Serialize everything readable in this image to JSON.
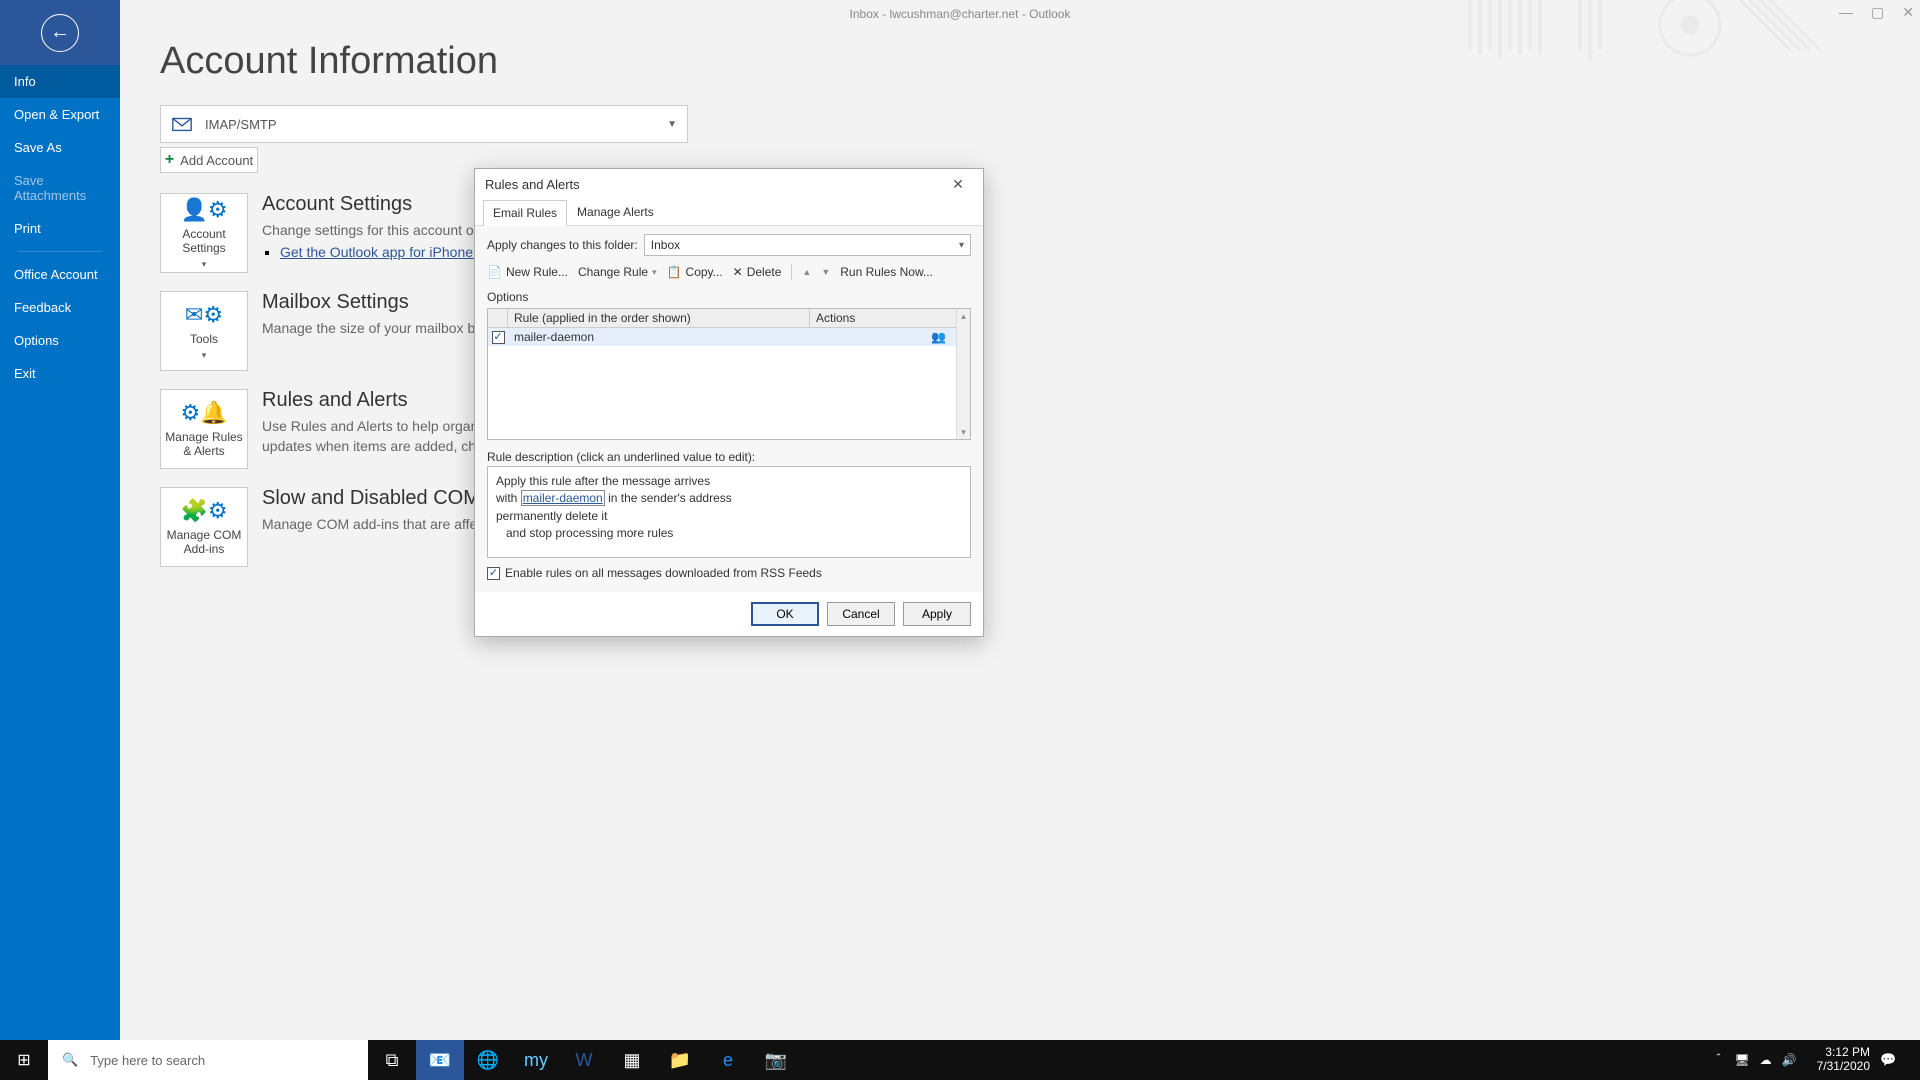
{
  "window_title": "Inbox - lwcushman@charter.net  -  Outlook",
  "back": "←",
  "sidebar": {
    "items": [
      "Info",
      "Open & Export",
      "Save As",
      "Save Attachments",
      "Print",
      "Office Account",
      "Feedback",
      "Options",
      "Exit"
    ]
  },
  "page_title": "Account Information",
  "account_type": "IMAP/SMTP",
  "add_account": "Add Account",
  "sections": {
    "settings": {
      "tile": "Account Settings",
      "title": "Account Settings",
      "desc": "Change settings for this account or set up",
      "link": "Get the Outlook app for iPhone, iPad"
    },
    "mailbox": {
      "tile": "Tools",
      "title": "Mailbox Settings",
      "desc": "Manage the size of your mailbox by emp"
    },
    "rules": {
      "tile": "Manage Rules & Alerts",
      "title": "Rules and Alerts",
      "desc": "Use Rules and Alerts to help organize yo",
      "desc2": "updates when items are added, changed"
    },
    "com": {
      "tile": "Manage COM Add-ins",
      "title": "Slow and Disabled COM Ad",
      "desc": "Manage COM add-ins that are affecting"
    }
  },
  "dialog": {
    "title": "Rules and Alerts",
    "tabs": [
      "Email Rules",
      "Manage Alerts"
    ],
    "folder_label": "Apply changes to this folder:",
    "folder_value": "Inbox",
    "toolbar": {
      "new": "New Rule...",
      "change": "Change Rule",
      "copy": "Copy...",
      "delete": "Delete",
      "run": "Run Rules Now...",
      "options": "Options"
    },
    "grid": {
      "col_rule": "Rule (applied in the order shown)",
      "col_actions": "Actions",
      "row1_name": "mailer-daemon"
    },
    "desc_label": "Rule description (click an underlined value to edit):",
    "desc_lines": {
      "l1": "Apply this rule after the message arrives",
      "l2a": "with ",
      "l2b": "mailer-daemon",
      "l2c": " in the sender's address",
      "l3": "permanently delete it",
      "l4": "   and stop processing more rules"
    },
    "rss": "Enable rules on all messages downloaded from RSS Feeds",
    "buttons": {
      "ok": "OK",
      "cancel": "Cancel",
      "apply": "Apply"
    }
  },
  "taskbar": {
    "search_placeholder": "Type here to search",
    "time": "3:12 PM",
    "date": "7/31/2020"
  }
}
